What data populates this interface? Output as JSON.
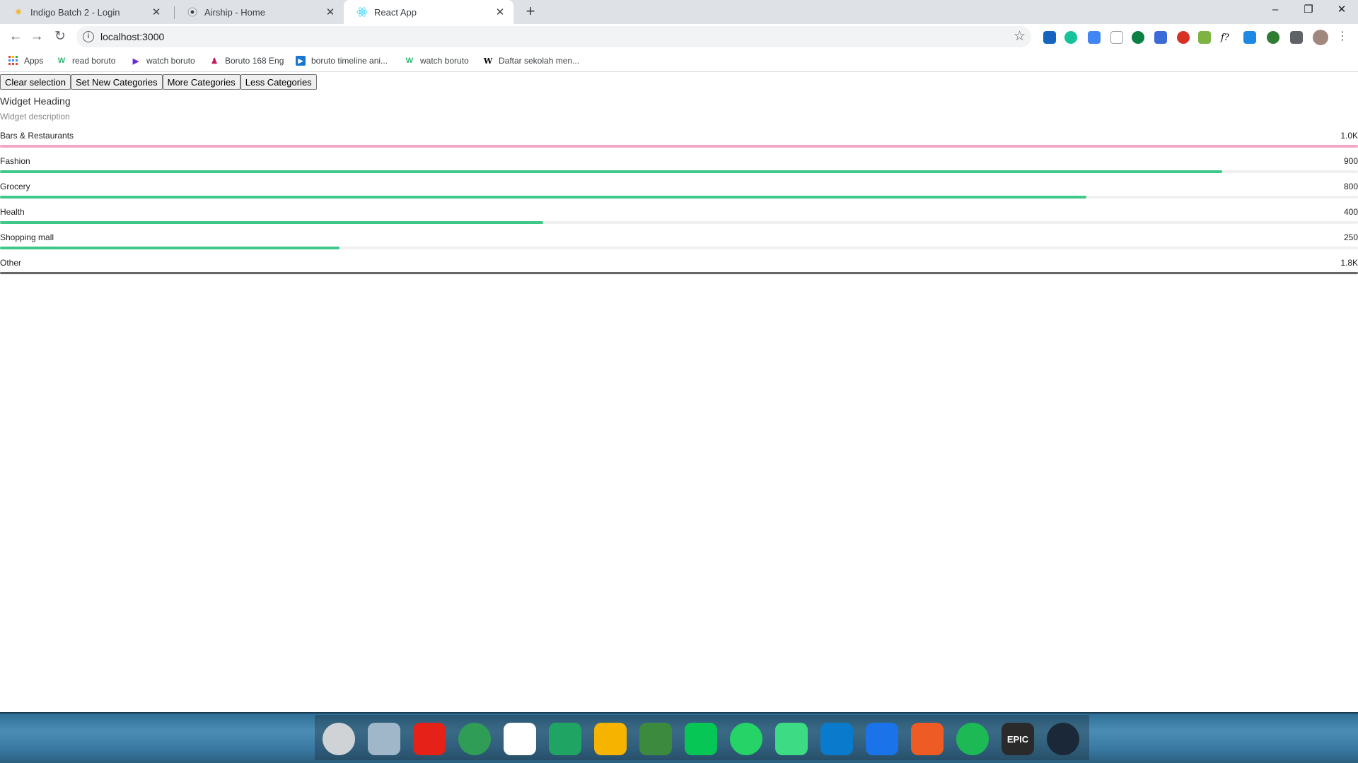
{
  "browser": {
    "tabs": [
      {
        "title": "Indigo Batch 2 - Login",
        "icon": "indigo-favicon",
        "active": false
      },
      {
        "title": "Airship - Home",
        "icon": "airship-favicon",
        "active": false
      },
      {
        "title": "React App",
        "icon": "react-favicon",
        "active": true
      }
    ],
    "new_tab_glyph": "+",
    "window_controls": {
      "minimize": "–",
      "restore": "❐",
      "close": "✕"
    },
    "url": "localhost:3000",
    "bookmarks": [
      {
        "label": "Apps",
        "icon": "apps-grid-icon"
      },
      {
        "label": "read boruto",
        "icon": "webtoon-icon"
      },
      {
        "label": "watch boruto",
        "icon": "play-icon"
      },
      {
        "label": "Boruto 168 Eng",
        "icon": "anime-icon"
      },
      {
        "label": "boruto timeline ani...",
        "icon": "video-icon"
      },
      {
        "label": "watch boruto",
        "icon": "webtoon-icon"
      },
      {
        "label": "Daftar sekolah men...",
        "icon": "wikipedia-icon"
      }
    ]
  },
  "page": {
    "buttons": [
      "Clear selection",
      "Set New Categories",
      "More Categories",
      "Less Categories"
    ],
    "widget": {
      "heading": "Widget Heading",
      "description": "Widget description",
      "categories": [
        {
          "label": "Bars & Restaurants",
          "value": "1.0K",
          "fraction": 1.0,
          "color": "#f4a6c6"
        },
        {
          "label": "Fashion",
          "value": "900",
          "fraction": 0.9,
          "color": "#3ec98a"
        },
        {
          "label": "Grocery",
          "value": "800",
          "fraction": 0.8,
          "color": "#3ec98a"
        },
        {
          "label": "Health",
          "value": "400",
          "fraction": 0.4,
          "color": "#3ec98a"
        },
        {
          "label": "Shopping mall",
          "value": "250",
          "fraction": 0.25,
          "color": "#3ec98a"
        },
        {
          "label": "Other",
          "value": "1.8K",
          "fraction": 1.0,
          "color": "#666666"
        }
      ]
    }
  },
  "dock": {
    "apps": [
      {
        "name": "clock-app-icon",
        "color": "#cfd3d6"
      },
      {
        "name": "trash-icon",
        "color": "#9fb7c9"
      },
      {
        "name": "youtube-icon",
        "color": "#e62117"
      },
      {
        "name": "chrome-icon",
        "color": "#2f9d55"
      },
      {
        "name": "gmail-icon",
        "color": "#ffffff"
      },
      {
        "name": "google-drive-icon",
        "color": "#1fa463"
      },
      {
        "name": "google-keep-icon",
        "color": "#f6b400"
      },
      {
        "name": "internet-download-manager-icon",
        "color": "#3b8a3e"
      },
      {
        "name": "line-icon",
        "color": "#06c755"
      },
      {
        "name": "whatsapp-icon",
        "color": "#25d366"
      },
      {
        "name": "android-studio-icon",
        "color": "#3ddc84"
      },
      {
        "name": "vscode-icon",
        "color": "#0a7acc"
      },
      {
        "name": "maps-pin-icon",
        "color": "#1a73e8"
      },
      {
        "name": "postman-icon",
        "color": "#ef5b25"
      },
      {
        "name": "spotify-icon",
        "color": "#1db954"
      },
      {
        "name": "epic-games-icon",
        "color": "#2a2a2a"
      },
      {
        "name": "steam-icon",
        "color": "#1b2838"
      }
    ],
    "epic_label": "EPIC"
  }
}
